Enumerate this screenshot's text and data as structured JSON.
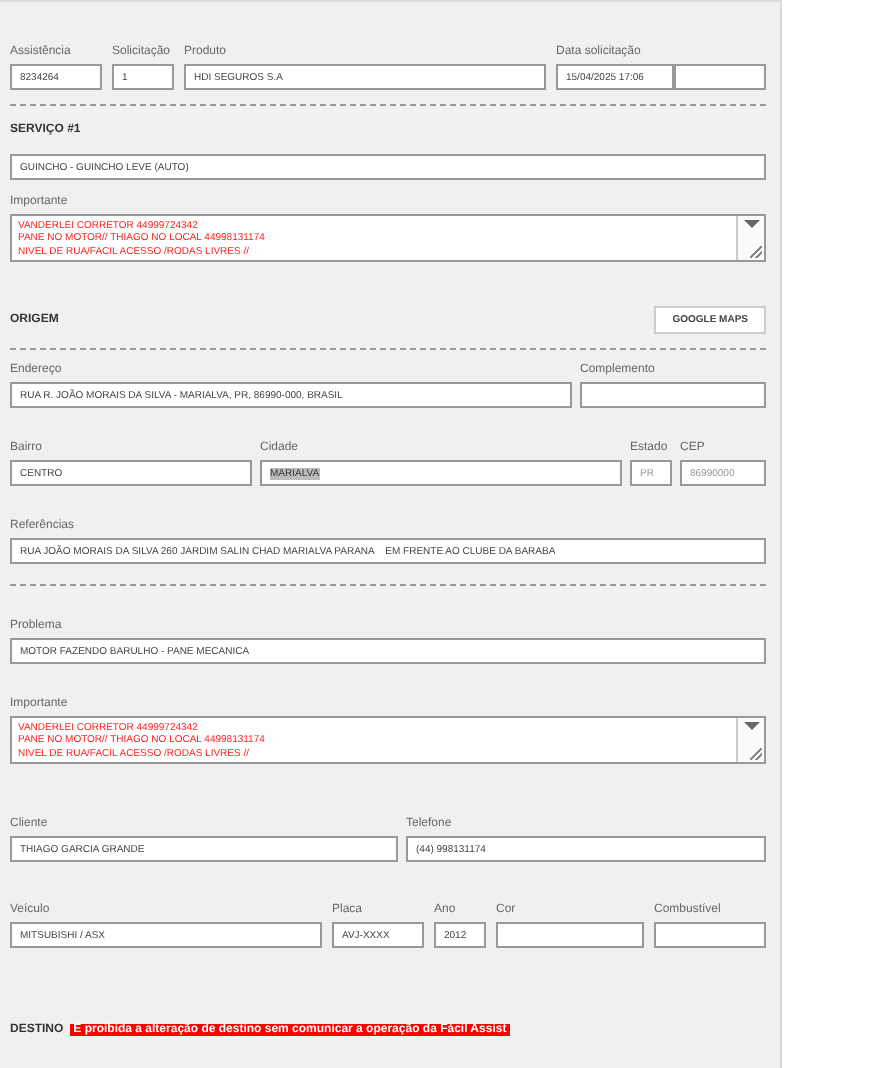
{
  "header": {
    "assistencia": {
      "label": "Assistência",
      "value": "8234264"
    },
    "solicitacao": {
      "label": "Solicitação",
      "value": "1"
    },
    "produto": {
      "label": "Produto",
      "value": "HDI SEGUROS S.A"
    },
    "data": {
      "label": "Data solicitação",
      "value": "15/04/2025 17:06"
    }
  },
  "servico": {
    "title": "SERVIÇO #1",
    "value": "GUINCHO - GUINCHO LEVE (AUTO)",
    "importante": {
      "label": "Importante",
      "lines": [
        "VANDERLEI CORRETOR 44999724342",
        "PANE NO MOTOR// THIAGO NO LOCAL 44998131174",
        "NIVEL DE RUA/FACIL ACESSO /RODAS LIVRES //"
      ]
    }
  },
  "origem": {
    "title": "ORIGEM",
    "button": "GOOGLE MAPS",
    "endereco": {
      "label": "Endereço",
      "value": "RUA R. JOÃO MORAIS DA SILVA - MARIALVA, PR, 86990-000, BRASIL"
    },
    "complemento": {
      "label": "Complemento"
    },
    "bairro": {
      "label": "Bairro",
      "value": "CENTRO",
      "disabled": false
    },
    "cidade": {
      "label": "Cidade",
      "value": "MARIALVA",
      "selected": true
    },
    "estado": {
      "label": "Estado",
      "value": "PR",
      "disabled": true
    },
    "cep": {
      "label": "CEP",
      "value": "86990000",
      "disabled": true
    },
    "referencias": {
      "label": "Referências",
      "value": "RUA JOÃO MORAIS DA SILVA 260 JARDIM SALIN CHAD MARIALVA PARANA    EM FRENTE AO CLUBE DA BARABA"
    }
  },
  "problema": {
    "label": "Problema",
    "value": "MOTOR FAZENDO BARULHO - PANE MECANICA"
  },
  "importante": {
    "label": "Importante",
    "lines": [
      "VANDERLEI CORRETOR 44999724342",
      "PANE NO MOTOR// THIAGO NO LOCAL 44998131174",
      "NIVEL DE RUA/FACIL ACESSO /RODAS LIVRES //"
    ]
  },
  "cliente": {
    "label": "Cliente",
    "value": "THIAGO GARCIA GRANDE"
  },
  "telefone": {
    "label": "Telefone",
    "value": "(44) 998131174"
  },
  "veiculo": {
    "label": "Veículo",
    "value": "MITSUBISHI / ASX"
  },
  "placa": {
    "label": "Placa",
    "value": "AVJ-XXXX"
  },
  "ano": {
    "label": "Ano",
    "value": "2012"
  },
  "cor": {
    "label": "Cor"
  },
  "combustivel": {
    "label": "Combustível"
  },
  "destino": {
    "title": "DESTINO",
    "warning": "É proibida a alteração de destino sem comunicar a operação da Fácil Assist"
  }
}
